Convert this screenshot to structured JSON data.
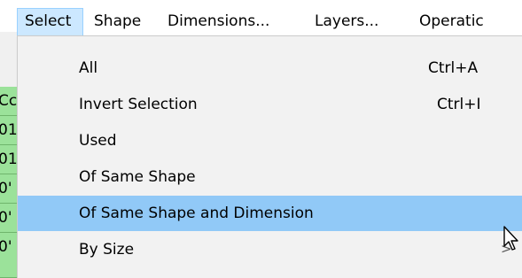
{
  "menubar": {
    "items": [
      {
        "label": "Select",
        "active": true
      },
      {
        "label": "Shape"
      },
      {
        "label": "Dimensions..."
      },
      {
        "label": "Layers..."
      },
      {
        "label": "Operatic"
      }
    ]
  },
  "left_strip": {
    "cells": [
      "Cc",
      "01",
      "01",
      "0'",
      "0'"
    ]
  },
  "select_menu": {
    "items": [
      {
        "label": "All",
        "shortcut": "Ctrl+A"
      },
      {
        "label": "Invert Selection",
        "shortcut": "Ctrl+I"
      },
      {
        "label": "Used",
        "shortcut": ""
      },
      {
        "label": "Of Same Shape",
        "shortcut": ""
      },
      {
        "label": "Of Same Shape and Dimension",
        "shortcut": "",
        "highlighted": true
      },
      {
        "label": "By Size",
        "shortcut": "",
        "submenu_arrow": ">"
      }
    ]
  },
  "icons": {
    "cursor": "mouse-pointer-icon",
    "submenu": "chevron-right-icon"
  },
  "colors": {
    "menu_background": "#f2f2f2",
    "highlight": "#91c9f7",
    "active_menubar": "#cce8ff",
    "grid_cell": "#9be29a"
  }
}
